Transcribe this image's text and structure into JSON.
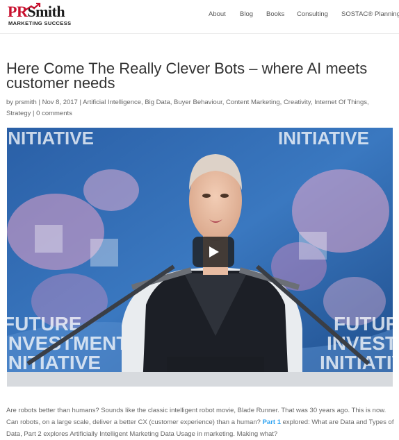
{
  "header": {
    "logo": {
      "brand_pr": "PR",
      "brand_smith": "Smith",
      "tagline": "MARKETING SUCCESS",
      "colors": {
        "red": "#c8102e",
        "dark": "#1b1b1b"
      }
    },
    "nav": [
      {
        "label": "About"
      },
      {
        "label": "Blog"
      },
      {
        "label": "Books"
      },
      {
        "label": "Consulting"
      },
      {
        "label": "SOSTAC® Planning"
      }
    ]
  },
  "post": {
    "title": "Here Come The Really Clever Bots – where AI meets customer needs",
    "meta": {
      "by": "by",
      "author": "prsmith",
      "sep1": " | ",
      "date": "Nov 8, 2017",
      "sep2": " | ",
      "categories": [
        "Artificial Intelligence",
        "Big Data",
        "Buyer Behaviour",
        "Content Marketing",
        "Creativity",
        "Internet Of Things",
        "Strategy"
      ],
      "sep3": " | ",
      "comments": "0 comments"
    },
    "video": {
      "backdrop_words": [
        "INITIATIVE",
        "INITIATIVE",
        "FUTURE",
        "INVESTMENT",
        "INITIATIVE",
        "FUTURE",
        "INVESTMENT",
        "INITIATIVE"
      ],
      "play_icon": "play-icon"
    },
    "body": {
      "text_before_link": "Are robots better than humans? Sounds like the classic intelligent robot movie, Blade Runner. That was 30 years ago. This is now. Can robots, on a large scale, deliver a better CX (customer experience) than a human? ",
      "link": "Part 1",
      "text_after_link": " explored:  What are Data and Types of Data, Part 2 explores Artificially Intelligent Marketing Data Usage in marketing. Making what?"
    }
  },
  "colors": {
    "link": "#2ea3f2",
    "title": "#333333",
    "text": "#666666"
  }
}
